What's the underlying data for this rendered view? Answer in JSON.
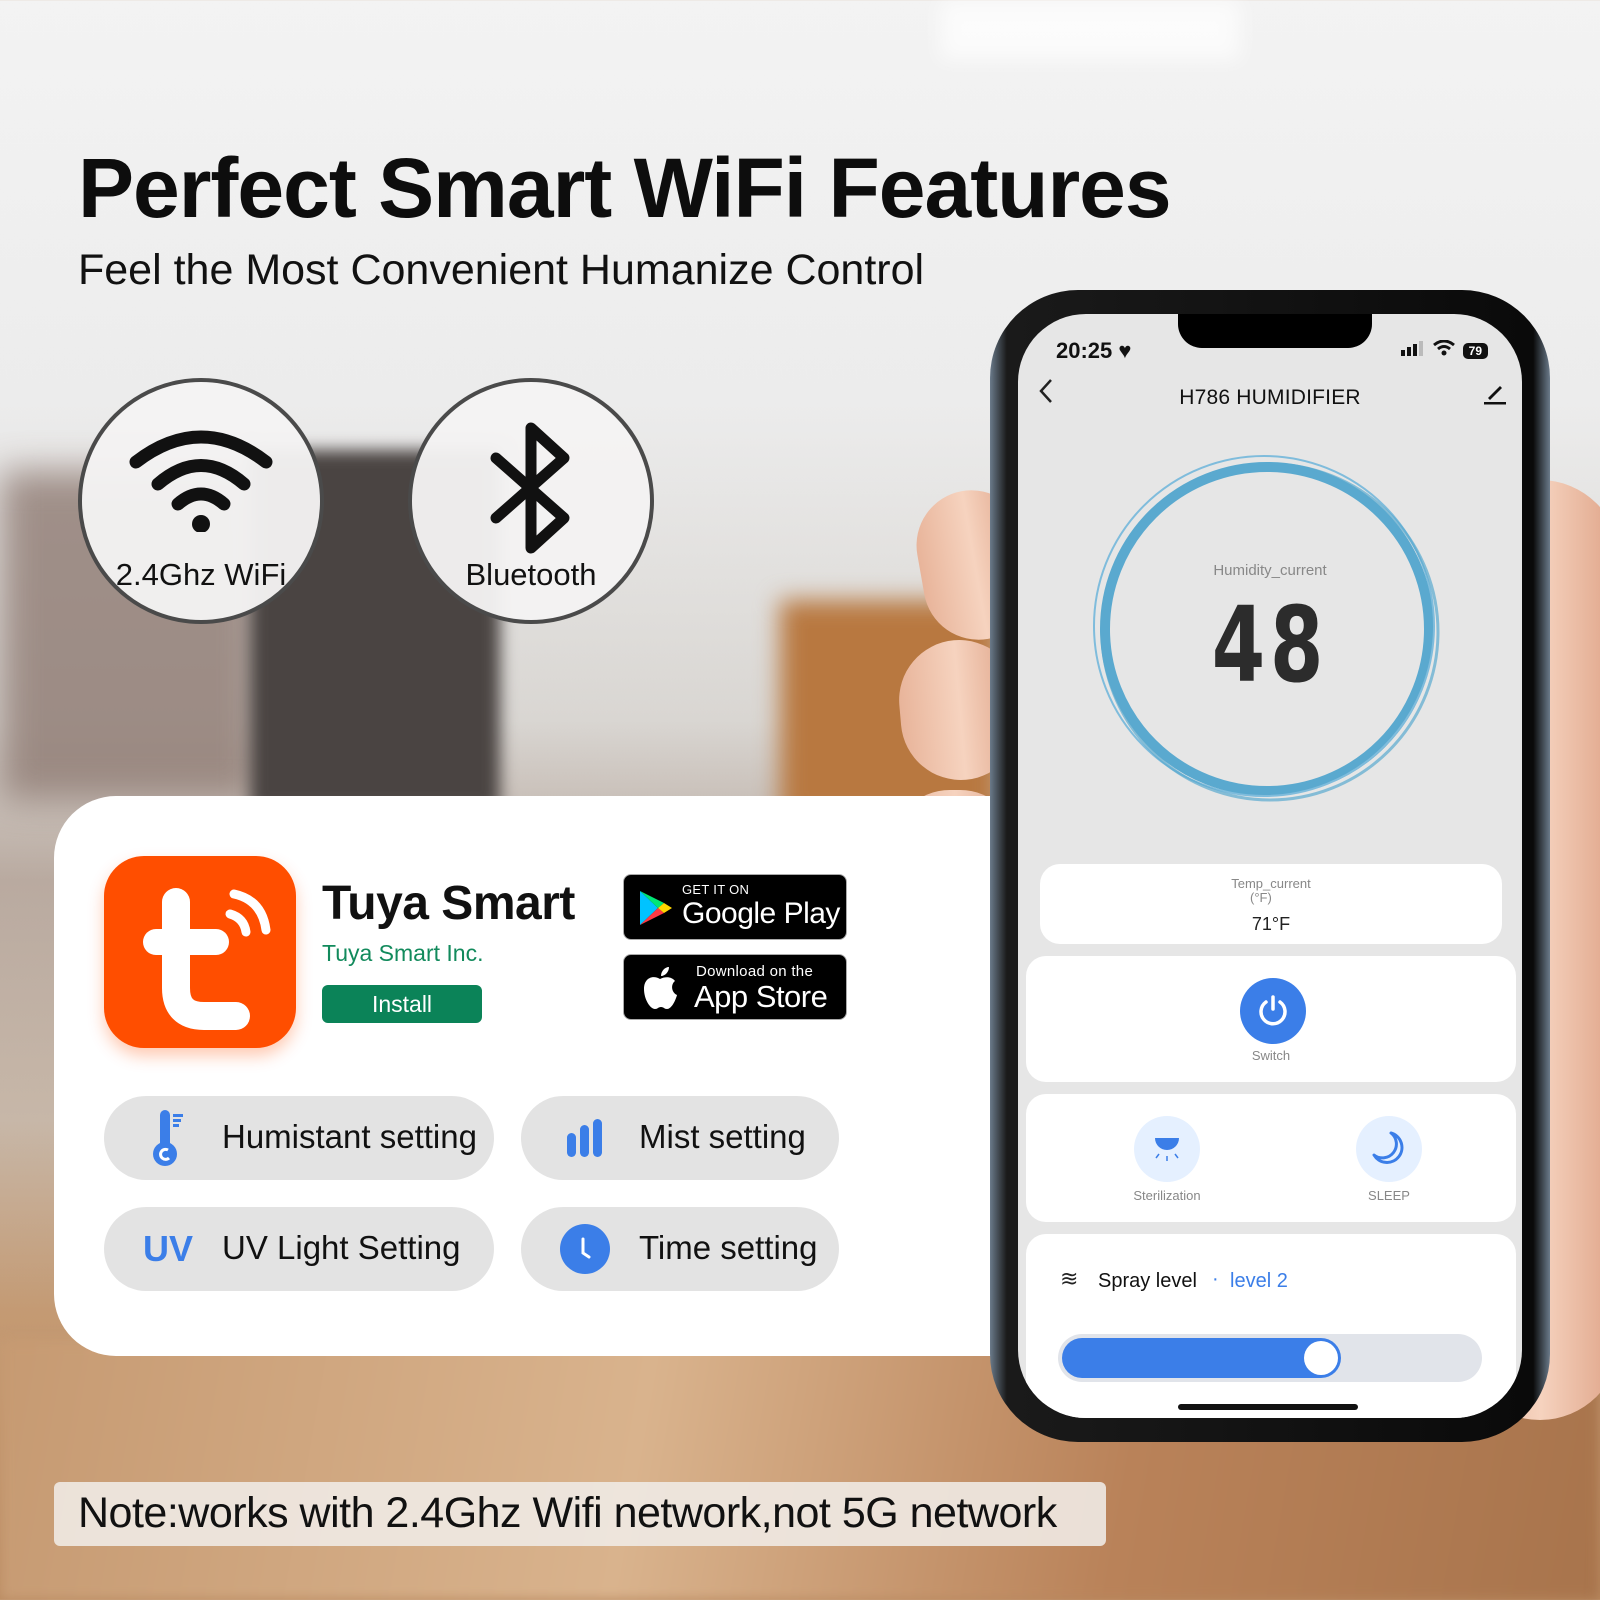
{
  "headline": "Perfect Smart WiFi Features",
  "subheadline": "Feel the Most Convenient Humanize Control",
  "connectivity": [
    {
      "icon": "wifi-icon",
      "label": "2.4Ghz WiFi"
    },
    {
      "icon": "bluetooth-icon",
      "label": "Bluetooth"
    }
  ],
  "app_listing": {
    "icon": "tuya-logo-icon",
    "name": "Tuya Smart",
    "developer": "Tuya Smart Inc.",
    "install_label": "Install",
    "colors": {
      "icon_bg": "#ff4e00",
      "install_bg": "#0b8358",
      "developer": "#128a5c"
    }
  },
  "store_badges": {
    "google_play": {
      "small": "GET IT ON",
      "big": "Google Play"
    },
    "app_store": {
      "small": "Download on the",
      "big": "App Store"
    }
  },
  "features": [
    {
      "icon": "thermometer-icon",
      "label": "Humistant setting"
    },
    {
      "icon": "signal-bars-icon",
      "label": "Mist setting"
    },
    {
      "icon": "uv-icon",
      "icon_text": "UV",
      "label": "UV Light Setting"
    },
    {
      "icon": "clock-icon",
      "label": "Time setting"
    }
  ],
  "note": "Note:works with 2.4Ghz Wifi network,not 5G network",
  "phone": {
    "status_bar": {
      "time": "20:25",
      "battery": "79"
    },
    "nav": {
      "title": "H786  HUMIDIFIER"
    },
    "humidity": {
      "label": "Humidity_current",
      "value": "48"
    },
    "temperature": {
      "label": "Temp_current",
      "unit": "(°F)",
      "value": "71°F"
    },
    "switch": {
      "label": "Switch",
      "on": true
    },
    "modes": [
      {
        "icon": "sterilization-lamp-icon",
        "label": "Sterilization"
      },
      {
        "icon": "moon-icon",
        "label": "SLEEP"
      }
    ],
    "spray": {
      "icon": "waves-icon",
      "label": "Spray level",
      "separator": "·",
      "value": "level 2",
      "slider_fraction": 0.67
    },
    "accent": "#3b7ee8"
  }
}
